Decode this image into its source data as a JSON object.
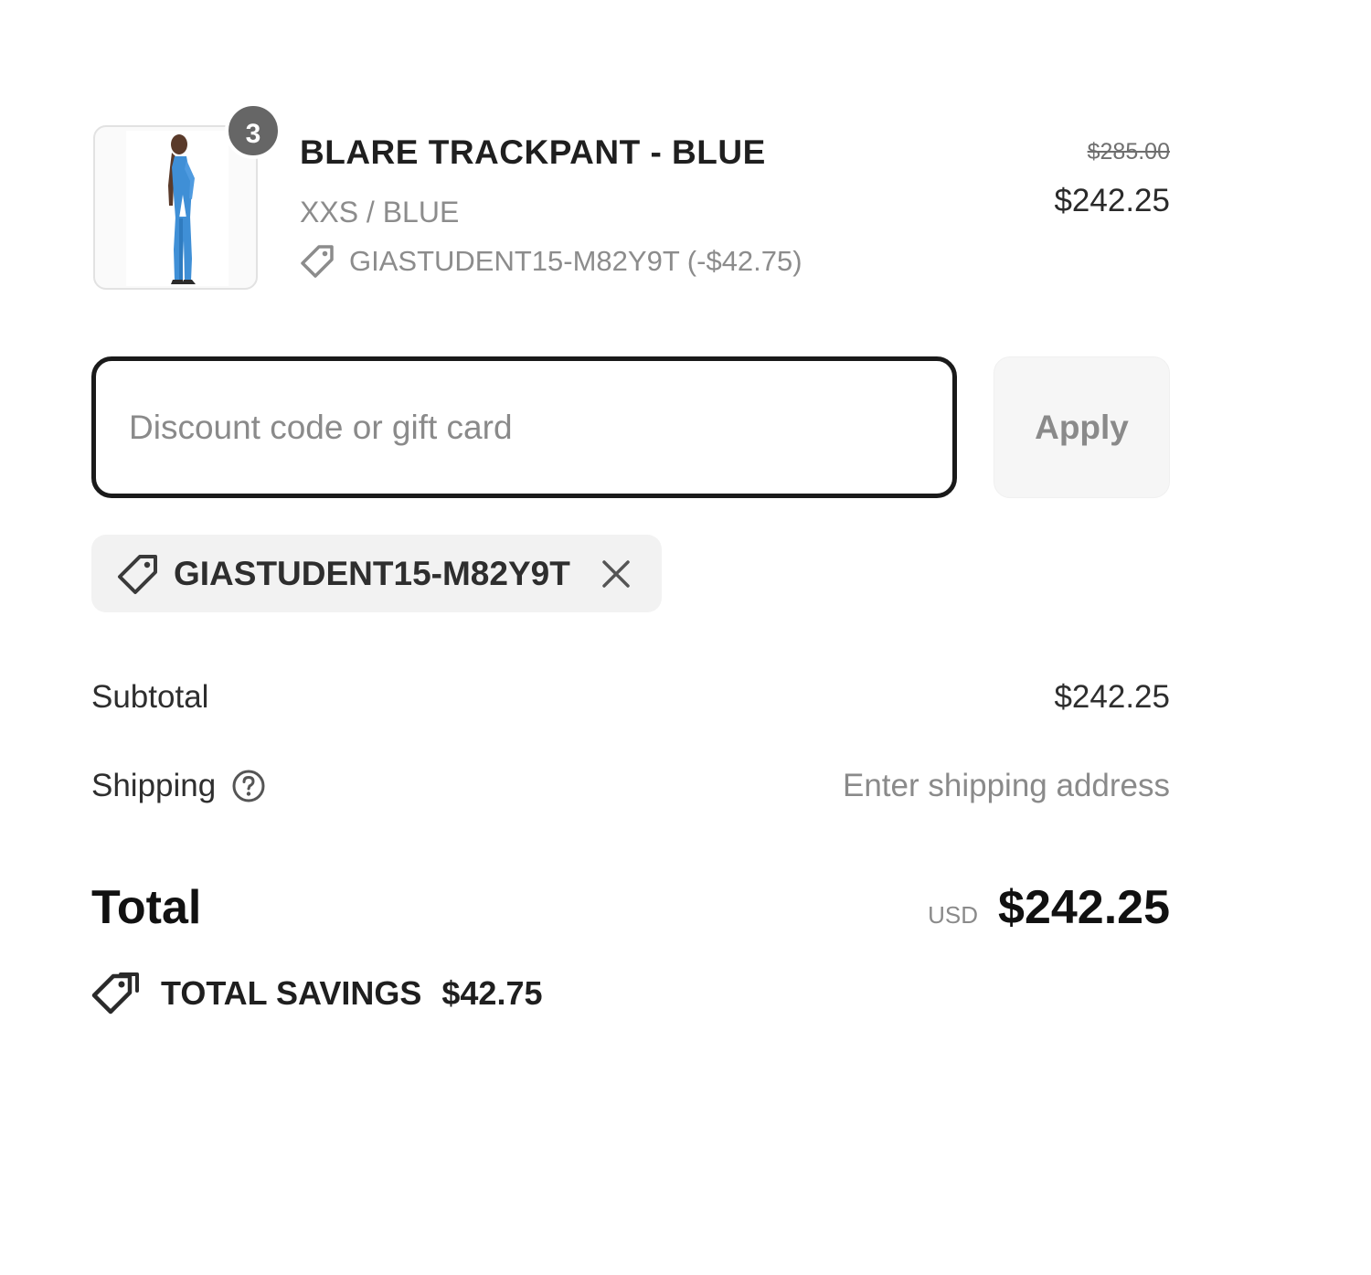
{
  "line_item": {
    "quantity": "3",
    "title": "BLARE TRACKPANT - BLUE",
    "variant": "XXS / BLUE",
    "discount_line": "GIASTUDENT15-M82Y9T (-$42.75)",
    "compare_at_price": "$285.00",
    "price": "$242.25",
    "image_icon": "product-photo-blue-trackpant"
  },
  "discount_form": {
    "placeholder": "Discount code or gift card",
    "apply_label": "Apply"
  },
  "applied_code": {
    "label": "GIASTUDENT15-M82Y9T",
    "tag_icon": "tag-icon",
    "remove_icon": "close-icon"
  },
  "totals": {
    "subtotal_label": "Subtotal",
    "subtotal_value": "$242.25",
    "shipping_label": "Shipping",
    "shipping_value": "Enter shipping address",
    "total_label": "Total",
    "currency": "USD",
    "total_value": "$242.25",
    "savings_label": "TOTAL SAVINGS",
    "savings_value": "$42.75"
  },
  "colors": {
    "text": "#1a1a1a",
    "muted": "#8a8a8a",
    "badge": "#666666",
    "chip_bg": "#f2f2f2",
    "product_blue": "#3f8fd6"
  }
}
